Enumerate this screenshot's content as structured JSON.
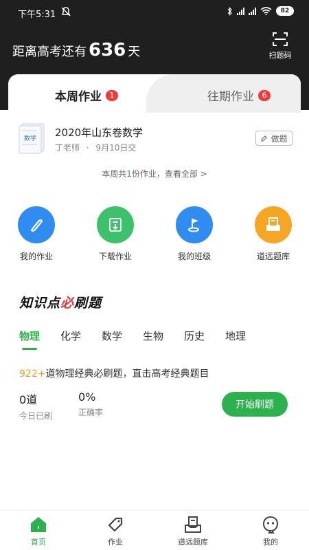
{
  "status": {
    "time": "下午5:31",
    "battery": "82"
  },
  "header": {
    "countdown_prefix": "距离高考还有",
    "countdown_days": "636",
    "countdown_suffix": "天",
    "scan_label": "扫题码"
  },
  "tabs": [
    {
      "label": "本周作业",
      "badge": "1"
    },
    {
      "label": "往期作业",
      "badge": "6"
    }
  ],
  "homework": {
    "icon_text": "数学",
    "title": "2020年山东卷数学",
    "teacher": "丁老师",
    "separator": "·",
    "due": "9月10日交",
    "do_label": "做题"
  },
  "summary": {
    "prefix": "本周共",
    "count": "1",
    "suffix": "份作业，查看全部 >"
  },
  "quick": [
    {
      "label": "我的作业",
      "color": "#2f8cf0"
    },
    {
      "label": "下载作业",
      "color": "#3cc26a"
    },
    {
      "label": "我的班级",
      "color": "#2f8cf0"
    },
    {
      "label": "道远题库",
      "color": "#f5a623"
    }
  ],
  "knowledge": {
    "title_a": "知识点",
    "title_b": "必",
    "title_c": "刷题",
    "subjects": [
      "物理",
      "化学",
      "数学",
      "生物",
      "历史",
      "地理"
    ],
    "active_subject": "物理",
    "desc_count": "922+",
    "desc_text": "道物理经典必刷题，直击高考经典题目",
    "today_value": "0道",
    "today_label": "今日已刷",
    "rate_value": "0%",
    "rate_label": "正确率",
    "start_label": "开始刷题"
  },
  "nav": [
    {
      "label": "首页",
      "icon": "home-icon",
      "active": true
    },
    {
      "label": "作业",
      "icon": "tag-icon",
      "active": false
    },
    {
      "label": "道远题库",
      "icon": "question-bank-icon",
      "active": false
    },
    {
      "label": "我的",
      "icon": "profile-icon",
      "active": false
    }
  ],
  "colors": {
    "accent": "#2bb24c",
    "badge": "#ef3b3b",
    "header_bg": "#1f1f1f"
  }
}
